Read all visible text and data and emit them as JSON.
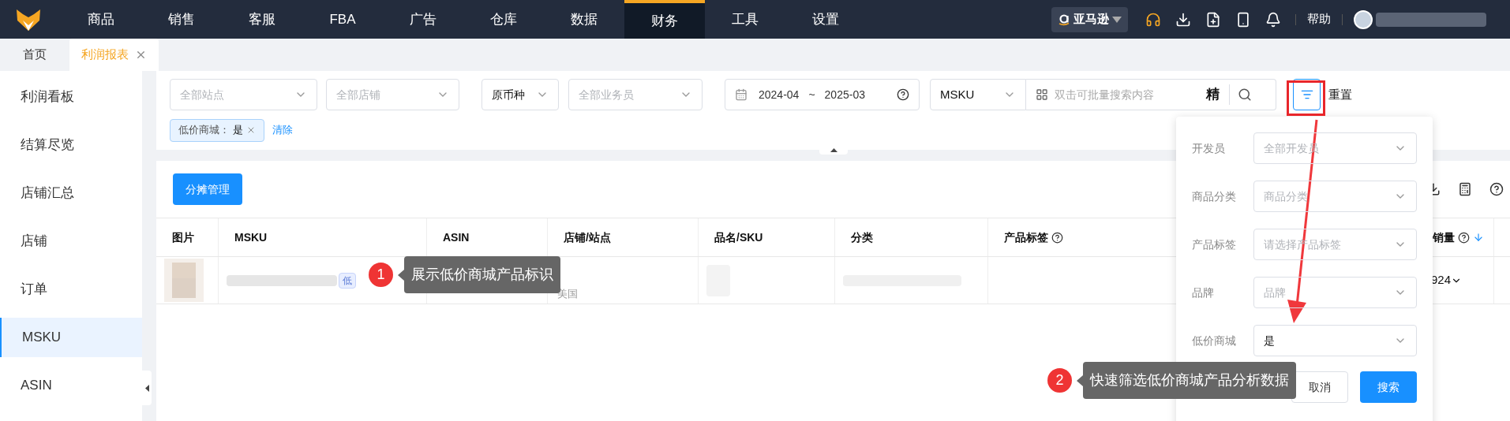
{
  "nav": {
    "items": [
      {
        "label": "商品",
        "selected": false
      },
      {
        "label": "销售",
        "selected": false
      },
      {
        "label": "客服",
        "selected": false
      },
      {
        "label": "FBA",
        "selected": false
      },
      {
        "label": "广告",
        "selected": false
      },
      {
        "label": "仓库",
        "selected": false
      },
      {
        "label": "数据",
        "selected": false
      },
      {
        "label": "财务",
        "selected": true
      },
      {
        "label": "工具",
        "selected": false
      },
      {
        "label": "设置",
        "selected": false
      }
    ],
    "platform": "亚马逊",
    "help": "帮助"
  },
  "tabs": [
    {
      "label": "首页",
      "selected": false,
      "closable": false
    },
    {
      "label": "利润报表",
      "selected": true,
      "closable": true
    }
  ],
  "sidebar": {
    "items": [
      {
        "label": "利润看板",
        "selected": false
      },
      {
        "label": "结算尽览",
        "selected": false
      },
      {
        "label": "店铺汇总",
        "selected": false
      },
      {
        "label": "店铺",
        "selected": false
      },
      {
        "label": "订单",
        "selected": false
      },
      {
        "label": "MSKU",
        "selected": true
      },
      {
        "label": "ASIN",
        "selected": false
      }
    ]
  },
  "filters": {
    "site": {
      "placeholder": "全部站点"
    },
    "store": {
      "placeholder": "全部店铺"
    },
    "currency": {
      "value": "原币种"
    },
    "staff": {
      "placeholder": "全部业务员"
    },
    "date_start": "2024-04",
    "date_sep": "~",
    "date_end": "2025-03",
    "search_type": "MSKU",
    "search": {
      "placeholder": "双击可批量搜索内容"
    },
    "exact": "精",
    "reset": "重置"
  },
  "active_filters": [
    {
      "label": "低价商城：",
      "value": "是"
    }
  ],
  "clear": "清除",
  "table": {
    "action": "分摊管理",
    "columns": [
      {
        "label": "图片",
        "kind": "plain"
      },
      {
        "label": "MSKU",
        "kind": "plain"
      },
      {
        "label": "ASIN",
        "kind": "plain"
      },
      {
        "label": "店铺/站点",
        "kind": "plain"
      },
      {
        "label": "品名/SKU",
        "kind": "plain"
      },
      {
        "label": "分类",
        "kind": "plain"
      },
      {
        "label": "产品标签",
        "kind": "help"
      },
      {
        "label": "销量",
        "kind": "sortable"
      }
    ],
    "rows": [
      {
        "badge": "低",
        "site": "美国",
        "sales": "924"
      }
    ]
  },
  "popup": {
    "fields": [
      {
        "label": "开发员",
        "placeholder": "全部开发员"
      },
      {
        "label": "商品分类",
        "placeholder": "商品分类"
      },
      {
        "label": "产品标签",
        "placeholder": "请选择产品标签"
      },
      {
        "label": "品牌",
        "placeholder": "品牌"
      },
      {
        "label": "低价商城",
        "value": "是"
      }
    ],
    "buttons": [
      {
        "label": "取消",
        "kind": "default"
      },
      {
        "label": "搜索",
        "kind": "primary"
      }
    ]
  },
  "callouts": [
    {
      "number": "1",
      "text": "展示低价商城产品标识"
    },
    {
      "number": "2",
      "text": "快速筛选低价商城产品分析数据"
    }
  ]
}
